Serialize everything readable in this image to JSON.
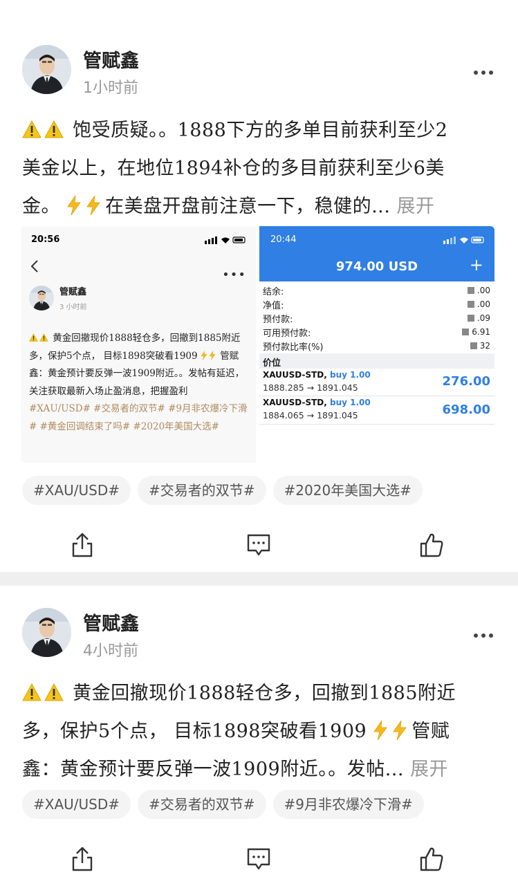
{
  "posts": [
    {
      "author": "管赋鑫",
      "time": "1小时前",
      "text_line1": "饱受质疑。。1888下方的多单目前获利至少2",
      "text_line2": "美金以上，在地位1894补仓的多目前获利至少6美",
      "text_line3_a": "金。",
      "text_line3_b": "在美盘开盘前注意一下，稳健的...",
      "expand": "展开",
      "tags": [
        "#XAU/USD#",
        "#交易者的双节#",
        "#2020年美国大选#"
      ],
      "screenshot_left": {
        "status_time": "20:56",
        "author": "管赋鑫",
        "time": "3 小时前",
        "text_a": "黄金回撤现价1888轻仓多，回撤到1885附近多，保护5个点， 目标1898突破看1909",
        "text_b": "管赋鑫：黄金预计要反弹一波1909附近。。发帖有延迟，关注获取最新入场止盈消息，把握盈利",
        "text_tags": "#XAU/USD# #交易者的双节# #9月非农爆冷下滑# #黄金回调结束了吗# #2020年美国大选#"
      },
      "screenshot_right": {
        "status_time": "20:44",
        "balance_title": "974.00 USD",
        "plus": "+",
        "rows": [
          {
            "label": "结余:",
            "value": ".00"
          },
          {
            "label": "净值:",
            "value": ".00"
          },
          {
            "label": "预付款:",
            "value": ".09"
          },
          {
            "label": "可用预付款:",
            "value": "6.91"
          },
          {
            "label": "预付款比率(%)",
            "value": "32"
          }
        ],
        "price_label": "价位",
        "trades": [
          {
            "symbol": "XAUUSD-STD,",
            "side": "buy 1.00",
            "prices": "1888.285 → 1891.045",
            "profit": "276.00"
          },
          {
            "symbol": "XAUUSD-STD,",
            "side": "buy 1.00",
            "prices": "1884.065 → 1891.045",
            "profit": "698.00"
          }
        ]
      }
    },
    {
      "author": "管赋鑫",
      "time": "4小时前",
      "text_line1": "黄金回撤现价1888轻仓多，回撤到1885附近",
      "text_line2_a": "多，保护5个点， 目标1898突破看1909",
      "text_line2_b": "管赋",
      "text_line3": "鑫：黄金预计要反弹一波1909附近。。发帖...",
      "expand": "展开",
      "tags": [
        "#XAU/USD#",
        "#交易者的双节#",
        "#9月非农爆冷下滑#"
      ]
    }
  ],
  "icons": [
    "more-icon",
    "warning-icon",
    "lightning-icon",
    "share-icon",
    "comment-icon",
    "like-icon"
  ],
  "colors": {
    "accent_blue": "#2f7fe4",
    "tag_bg": "#f4f4f4",
    "muted": "#999999"
  }
}
